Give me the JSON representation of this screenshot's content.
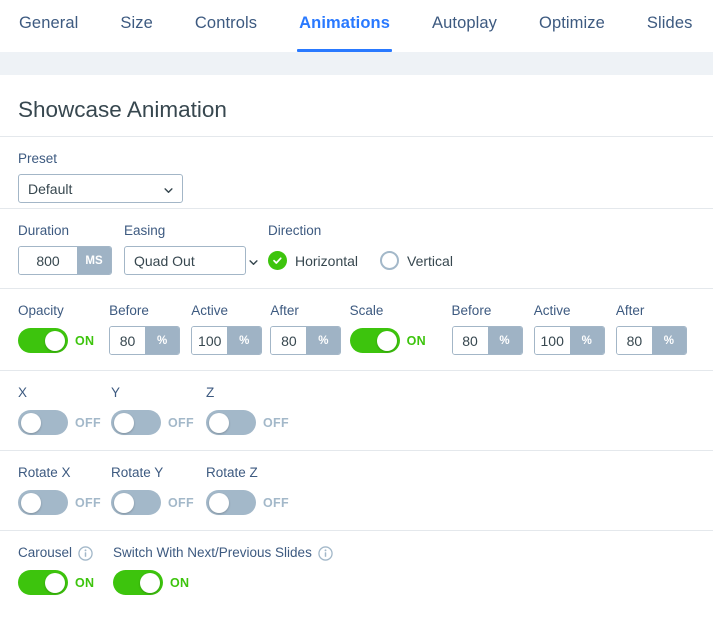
{
  "tabs": [
    {
      "label": "General",
      "active": false
    },
    {
      "label": "Size",
      "active": false
    },
    {
      "label": "Controls",
      "active": false
    },
    {
      "label": "Animations",
      "active": true
    },
    {
      "label": "Autoplay",
      "active": false
    },
    {
      "label": "Optimize",
      "active": false
    },
    {
      "label": "Slides",
      "active": false
    }
  ],
  "page": {
    "title": "Showcase Animation"
  },
  "preset": {
    "label": "Preset",
    "value": "Default",
    "options": [
      "Default"
    ]
  },
  "duration": {
    "label": "Duration",
    "value": "800",
    "unit": "MS"
  },
  "easing": {
    "label": "Easing",
    "value": "Quad Out",
    "options": [
      "Quad Out"
    ]
  },
  "direction": {
    "label": "Direction",
    "options": [
      {
        "label": "Horizontal",
        "checked": true
      },
      {
        "label": "Vertical",
        "checked": false
      }
    ]
  },
  "opacity": {
    "label": "Opacity",
    "state": "ON",
    "on": true,
    "before": {
      "label": "Before",
      "value": "80",
      "unit": "%"
    },
    "active": {
      "label": "Active",
      "value": "100",
      "unit": "%"
    },
    "after": {
      "label": "After",
      "value": "80",
      "unit": "%"
    }
  },
  "scale": {
    "label": "Scale",
    "state": "ON",
    "on": true,
    "before": {
      "label": "Before",
      "value": "80",
      "unit": "%"
    },
    "active": {
      "label": "Active",
      "value": "100",
      "unit": "%"
    },
    "after": {
      "label": "After",
      "value": "80",
      "unit": "%"
    }
  },
  "axes": [
    {
      "label": "X",
      "state": "OFF",
      "on": false
    },
    {
      "label": "Y",
      "state": "OFF",
      "on": false
    },
    {
      "label": "Z",
      "state": "OFF",
      "on": false
    }
  ],
  "rotate": [
    {
      "label": "Rotate X",
      "state": "OFF",
      "on": false
    },
    {
      "label": "Rotate Y",
      "state": "OFF",
      "on": false
    },
    {
      "label": "Rotate Z",
      "state": "OFF",
      "on": false
    }
  ],
  "carousel": {
    "label": "Carousel",
    "state": "ON",
    "on": true,
    "info": "info-icon"
  },
  "switch_slides": {
    "label": "Switch With Next/Previous Slides",
    "state": "ON",
    "on": true,
    "info": "info-icon"
  },
  "colors": {
    "accent": "#2979ff",
    "toggle_on": "#3dc40d",
    "toggle_off": "#a3b8c9",
    "label_text": "#3d5a80",
    "body_text": "#37474f",
    "band": "#eef2f6",
    "border": "#e4e8ec",
    "input_border": "#a3b6c7",
    "unit_bg": "#9fb3c5"
  }
}
